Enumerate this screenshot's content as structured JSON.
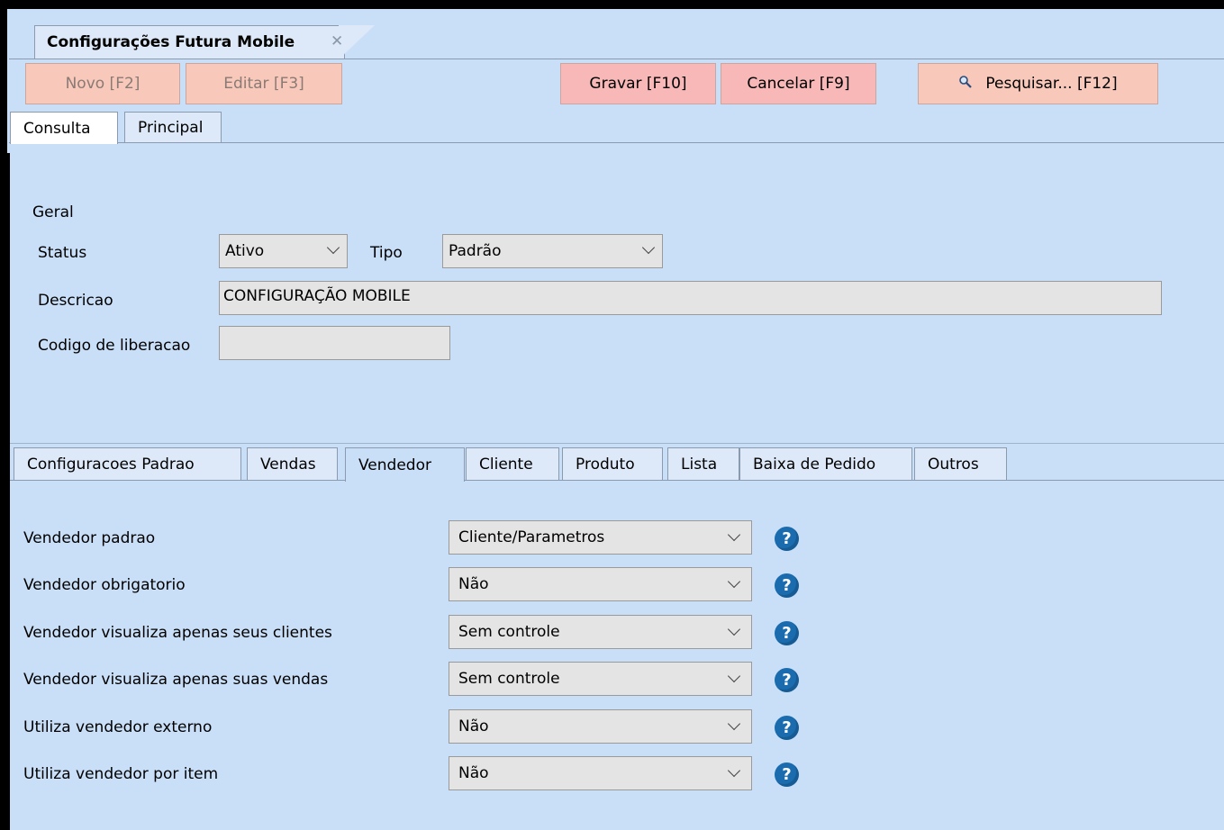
{
  "window": {
    "tab_title": "Configurações Futura Mobile",
    "close_glyph": "✕"
  },
  "toolbar": {
    "novo": "Novo [F2]",
    "editar": "Editar [F3]",
    "gravar": "Gravar [F10]",
    "cancelar": "Cancelar [F9]",
    "pesquisar": "Pesquisar... [F12]",
    "search_icon": "magnifier-icon"
  },
  "main_tabs": [
    "Consulta",
    "Principal"
  ],
  "geral": {
    "section_label": "Geral",
    "status_label": "Status",
    "status_value": "Ativo",
    "tipo_label": "Tipo",
    "tipo_value": "Padrão",
    "descricao_label": "Descricao",
    "descricao_value": "CONFIGURAÇÃO MOBILE",
    "codigo_label": "Codigo de liberacao",
    "codigo_value": ""
  },
  "sub_tabs": [
    "Configuracoes Padrao",
    "Vendas",
    "Vendedor",
    "Cliente",
    "Produto",
    "Lista",
    "Baixa de Pedido",
    "Outros"
  ],
  "selected_sub_tab": "Vendedor",
  "vendedor_settings": [
    {
      "label": "Vendedor padrao",
      "value": "Cliente/Parametros"
    },
    {
      "label": "Vendedor obrigatorio",
      "value": "Não"
    },
    {
      "label": "Vendedor visualiza apenas seus clientes",
      "value": "Sem controle"
    },
    {
      "label": "Vendedor visualiza apenas suas vendas",
      "value": "Sem controle"
    },
    {
      "label": "Utiliza vendedor externo",
      "value": "Não"
    },
    {
      "label": "Utiliza vendedor por item",
      "value": "Não"
    }
  ],
  "help_glyph": "?",
  "colors": {
    "background": "#c9def7",
    "button_disabled": "#f8c9bb",
    "button_active": "#f8b8b8",
    "help_icon": "#1a6cae"
  }
}
